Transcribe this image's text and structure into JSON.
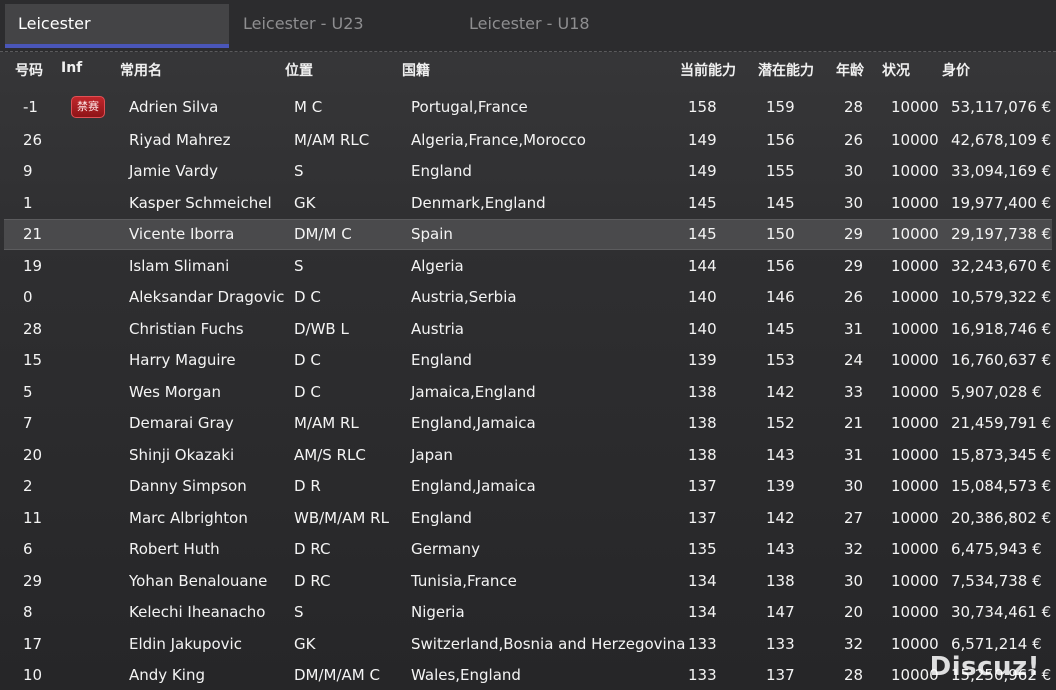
{
  "tabs": [
    {
      "label": "Leicester",
      "active": true
    },
    {
      "label": "Leicester - U23",
      "active": false
    },
    {
      "label": "Leicester - U18",
      "active": false
    }
  ],
  "columns": {
    "num": "号码",
    "inf": "Inf",
    "name": "常用名",
    "pos": "位置",
    "nat": "国籍",
    "ca": "当前能力",
    "pa": "潜在能力",
    "age": "年龄",
    "cond": "状况",
    "value": "身价"
  },
  "rows": [
    {
      "num": "-1",
      "inf": "禁赛",
      "name": "Adrien Silva",
      "pos": "M C",
      "nat": "Portugal,France",
      "ca": "158",
      "pa": "159",
      "age": "28",
      "cond": "10000",
      "value": "53,117,076 €"
    },
    {
      "num": "26",
      "inf": "",
      "name": "Riyad Mahrez",
      "pos": "M/AM RLC",
      "nat": "Algeria,France,Morocco",
      "ca": "149",
      "pa": "156",
      "age": "26",
      "cond": "10000",
      "value": "42,678,109 €"
    },
    {
      "num": "9",
      "inf": "",
      "name": "Jamie Vardy",
      "pos": "S",
      "nat": "England",
      "ca": "149",
      "pa": "155",
      "age": "30",
      "cond": "10000",
      "value": "33,094,169 €"
    },
    {
      "num": "1",
      "inf": "",
      "name": "Kasper Schmeichel",
      "pos": "GK",
      "nat": "Denmark,England",
      "ca": "145",
      "pa": "145",
      "age": "30",
      "cond": "10000",
      "value": "19,977,400 €"
    },
    {
      "num": "21",
      "inf": "",
      "name": "Vicente Iborra",
      "pos": "DM/M C",
      "nat": "Spain",
      "ca": "145",
      "pa": "150",
      "age": "29",
      "cond": "10000",
      "value": "29,197,738 €"
    },
    {
      "num": "19",
      "inf": "",
      "name": "Islam Slimani",
      "pos": "S",
      "nat": "Algeria",
      "ca": "144",
      "pa": "156",
      "age": "29",
      "cond": "10000",
      "value": "32,243,670 €"
    },
    {
      "num": "0",
      "inf": "",
      "name": "Aleksandar Dragovic",
      "pos": "D C",
      "nat": "Austria,Serbia",
      "ca": "140",
      "pa": "146",
      "age": "26",
      "cond": "10000",
      "value": "10,579,322 €"
    },
    {
      "num": "28",
      "inf": "",
      "name": "Christian Fuchs",
      "pos": "D/WB L",
      "nat": "Austria",
      "ca": "140",
      "pa": "145",
      "age": "31",
      "cond": "10000",
      "value": "16,918,746 €"
    },
    {
      "num": "15",
      "inf": "",
      "name": "Harry Maguire",
      "pos": "D C",
      "nat": "England",
      "ca": "139",
      "pa": "153",
      "age": "24",
      "cond": "10000",
      "value": "16,760,637 €"
    },
    {
      "num": "5",
      "inf": "",
      "name": "Wes Morgan",
      "pos": "D C",
      "nat": "Jamaica,England",
      "ca": "138",
      "pa": "142",
      "age": "33",
      "cond": "10000",
      "value": "5,907,028 €"
    },
    {
      "num": "7",
      "inf": "",
      "name": "Demarai Gray",
      "pos": "M/AM RL",
      "nat": "England,Jamaica",
      "ca": "138",
      "pa": "152",
      "age": "21",
      "cond": "10000",
      "value": "21,459,791 €"
    },
    {
      "num": "20",
      "inf": "",
      "name": "Shinji Okazaki",
      "pos": "AM/S RLC",
      "nat": "Japan",
      "ca": "138",
      "pa": "143",
      "age": "31",
      "cond": "10000",
      "value": "15,873,345 €"
    },
    {
      "num": "2",
      "inf": "",
      "name": "Danny Simpson",
      "pos": "D R",
      "nat": "England,Jamaica",
      "ca": "137",
      "pa": "139",
      "age": "30",
      "cond": "10000",
      "value": "15,084,573 €"
    },
    {
      "num": "11",
      "inf": "",
      "name": "Marc Albrighton",
      "pos": "WB/M/AM RL",
      "nat": "England",
      "ca": "137",
      "pa": "142",
      "age": "27",
      "cond": "10000",
      "value": "20,386,802 €"
    },
    {
      "num": "6",
      "inf": "",
      "name": "Robert Huth",
      "pos": "D RC",
      "nat": "Germany",
      "ca": "135",
      "pa": "143",
      "age": "32",
      "cond": "10000",
      "value": "6,475,943 €"
    },
    {
      "num": "29",
      "inf": "",
      "name": "Yohan Benalouane",
      "pos": "D RC",
      "nat": "Tunisia,France",
      "ca": "134",
      "pa": "138",
      "age": "30",
      "cond": "10000",
      "value": "7,534,738 €"
    },
    {
      "num": "8",
      "inf": "",
      "name": "Kelechi Iheanacho",
      "pos": "S",
      "nat": "Nigeria",
      "ca": "134",
      "pa": "147",
      "age": "20",
      "cond": "10000",
      "value": "30,734,461 €"
    },
    {
      "num": "17",
      "inf": "",
      "name": "Eldin Jakupovic",
      "pos": "GK",
      "nat": "Switzerland,Bosnia and Herzegovina",
      "ca": "133",
      "pa": "133",
      "age": "32",
      "cond": "10000",
      "value": "6,571,214 €"
    },
    {
      "num": "10",
      "inf": "",
      "name": "Andy King",
      "pos": "DM/M/AM C",
      "nat": "Wales,England",
      "ca": "133",
      "pa": "137",
      "age": "28",
      "cond": "10000",
      "value": "15,250,962 €"
    }
  ],
  "selected_row": 4,
  "watermark": "Discuz!"
}
